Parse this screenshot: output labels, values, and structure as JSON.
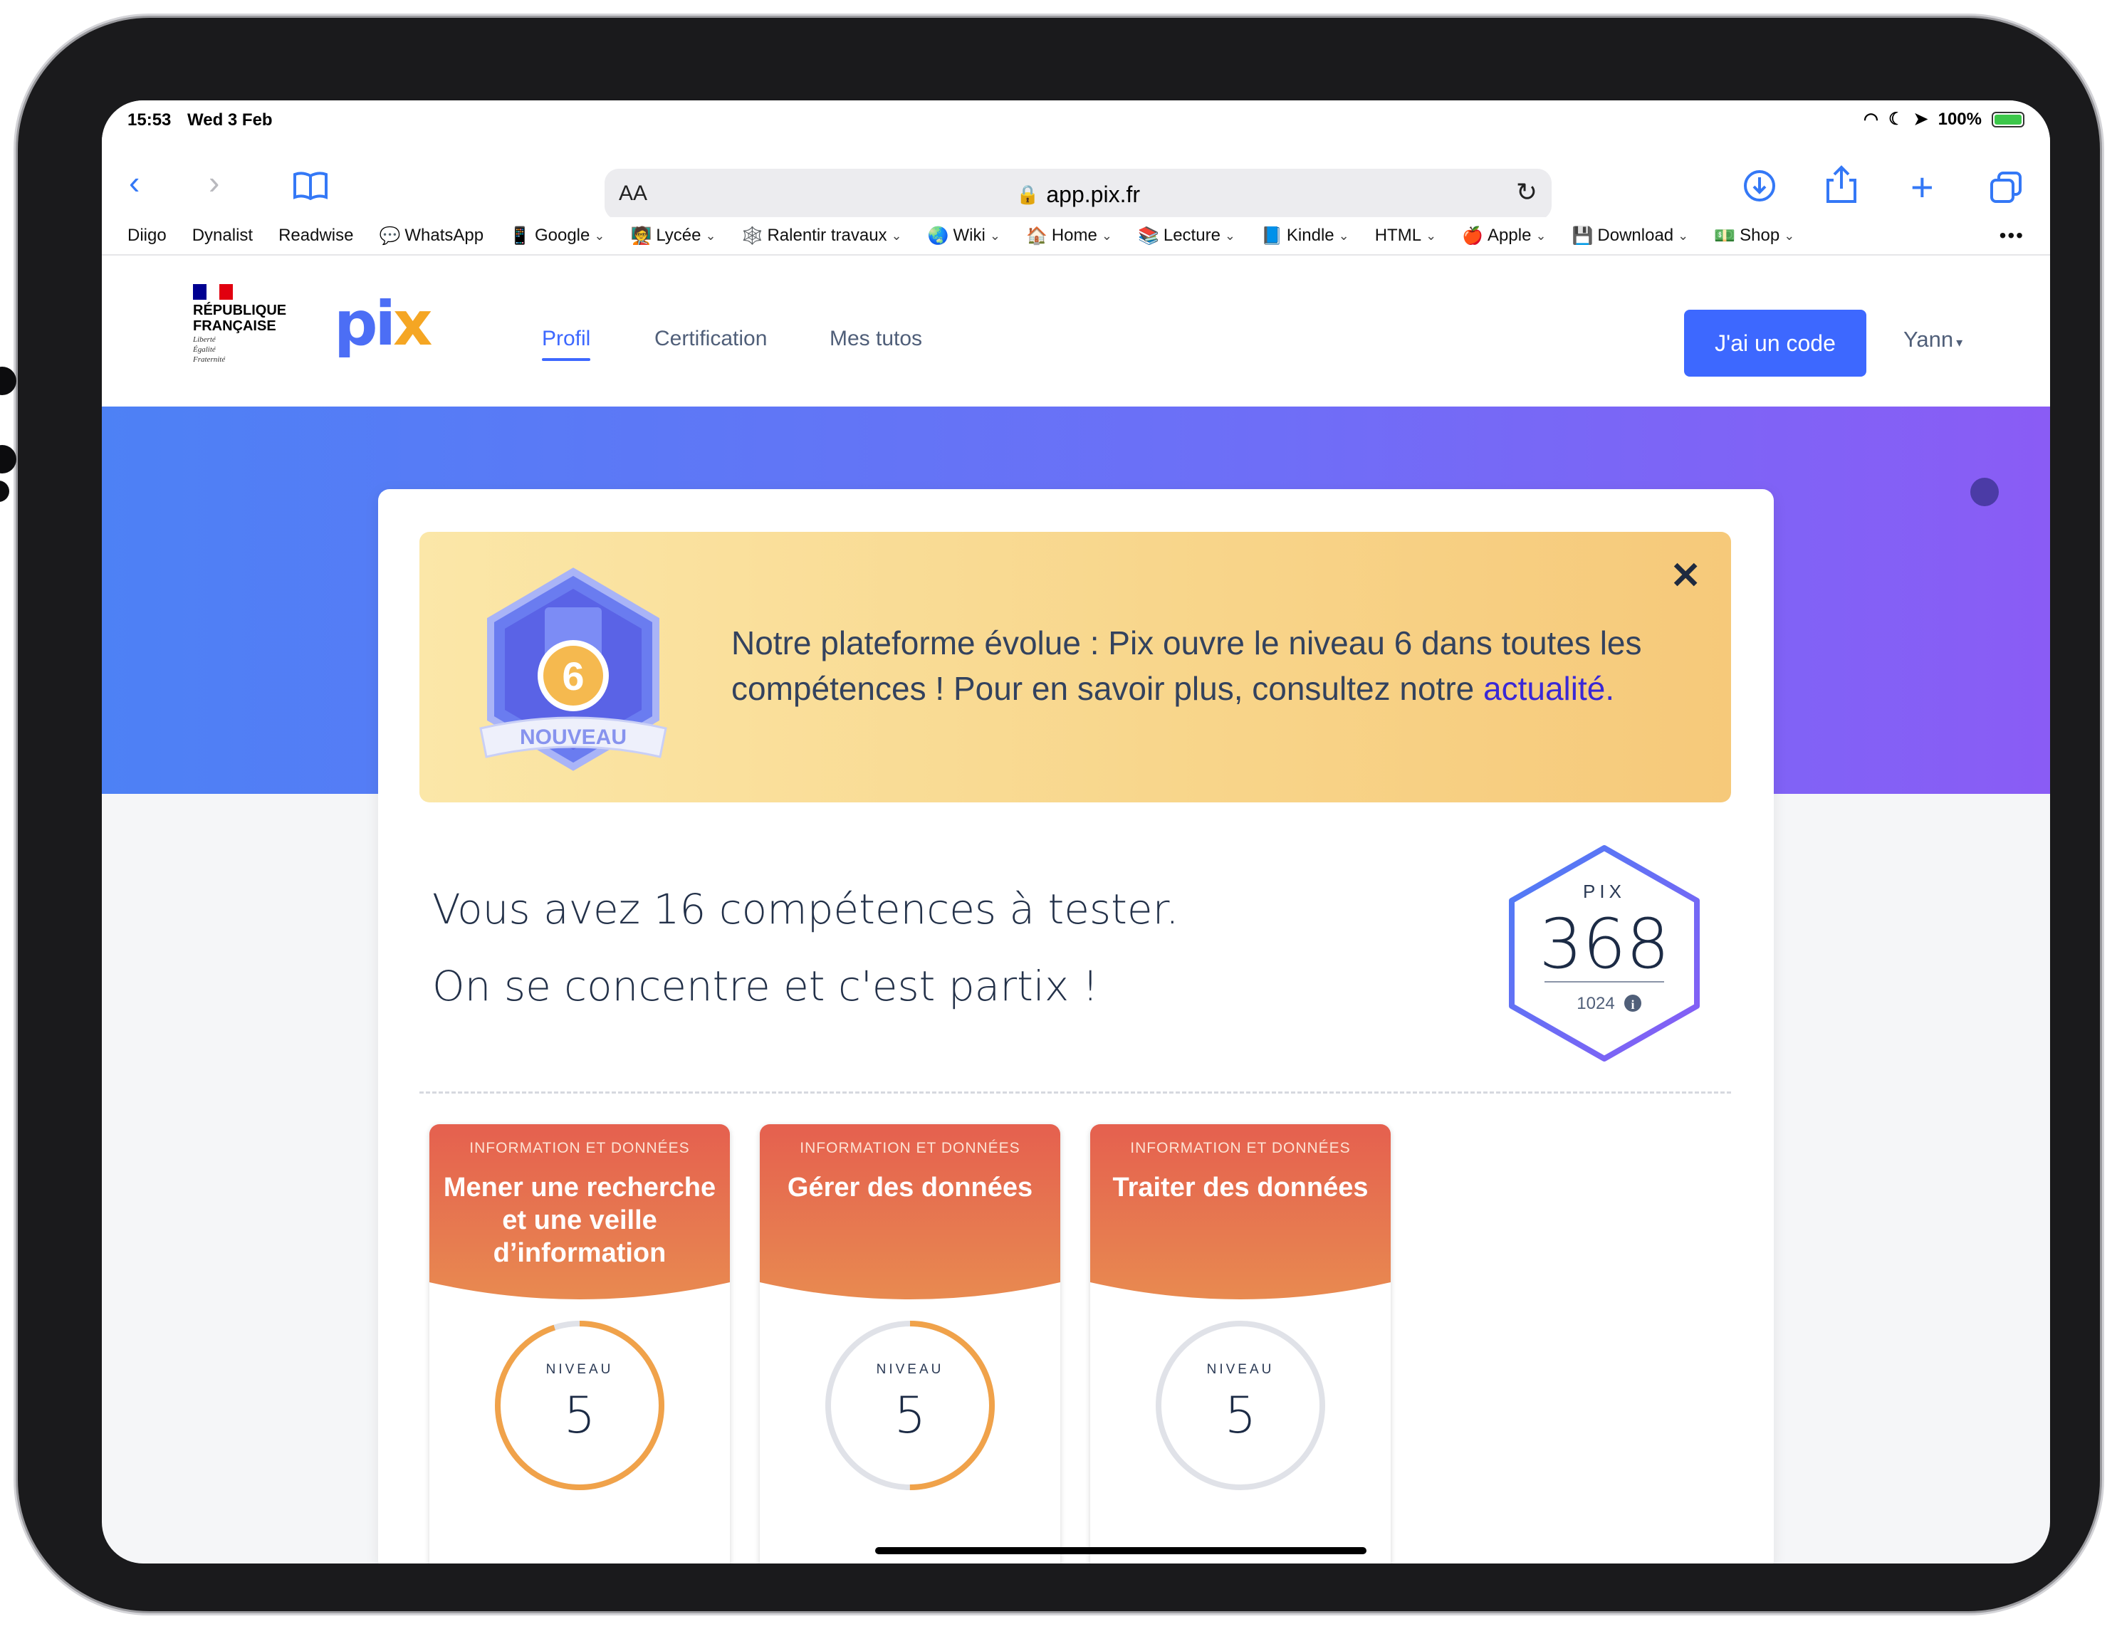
{
  "status_bar": {
    "time": "15:53",
    "date": "Wed 3 Feb",
    "battery": "100%"
  },
  "browser": {
    "url": "app.pix.fr",
    "aa_label": "AA",
    "bookmarks": [
      {
        "label": "Diigo",
        "icon": "",
        "has_menu": false
      },
      {
        "label": "Dynalist",
        "icon": "",
        "has_menu": false
      },
      {
        "label": "Readwise",
        "icon": "",
        "has_menu": false
      },
      {
        "label": "WhatsApp",
        "icon": "💬",
        "has_menu": false
      },
      {
        "label": "Google",
        "icon": "📱",
        "has_menu": true
      },
      {
        "label": "Lycée",
        "icon": "🧑‍🏫",
        "has_menu": true
      },
      {
        "label": "Ralentir travaux",
        "icon": "🕸️",
        "has_menu": true
      },
      {
        "label": "Wiki",
        "icon": "🌏",
        "has_menu": true
      },
      {
        "label": "Home",
        "icon": "🏠",
        "has_menu": true
      },
      {
        "label": "Lecture",
        "icon": "📚",
        "has_menu": true
      },
      {
        "label": "Kindle",
        "icon": "📘",
        "has_menu": true
      },
      {
        "label": "HTML",
        "icon": "",
        "has_menu": true
      },
      {
        "label": "Apple",
        "icon": "🍎",
        "has_menu": true
      },
      {
        "label": "Download",
        "icon": "💾",
        "has_menu": true
      },
      {
        "label": "Shop",
        "icon": "💵",
        "has_menu": true
      }
    ],
    "more_label": "•••"
  },
  "header": {
    "rf_line1": "RÉPUBLIQUE",
    "rf_line2": "FRANÇAISE",
    "rf_motto1": "Liberté",
    "rf_motto2": "Égalité",
    "rf_motto3": "Fraternité",
    "logo_main": "pi",
    "logo_x": "x",
    "nav": {
      "profil": "Profil",
      "certification": "Certification",
      "tutos": "Mes tutos"
    },
    "code_button": "J'ai un code",
    "user": "Yann"
  },
  "banner": {
    "text": "Notre plateforme évolue : Pix ouvre le niveau 6 dans toutes les compétences ! Pour en savoir plus, consultez notre ",
    "link": "actualité",
    "suffix": ".",
    "badge_number": "6",
    "badge_label": "NOUVEAU"
  },
  "intro": {
    "line1": "Vous avez 16 compétences à tester.",
    "line2": "On se concentre et c'est partix !"
  },
  "score": {
    "label": "PIX",
    "value": "368",
    "max": "1024"
  },
  "competences": [
    {
      "domain": "INFORMATION ET DONNÉES",
      "name": "Mener une recherche et une veille d’information",
      "level_label": "NIVEAU",
      "level": "5",
      "progress": 0.95
    },
    {
      "domain": "INFORMATION ET DONNÉES",
      "name": "Gérer des données",
      "level_label": "NIVEAU",
      "level": "5",
      "progress": 0.5
    },
    {
      "domain": "INFORMATION ET DONNÉES",
      "name": "Traiter des données",
      "level_label": "NIVEAU",
      "level": "5",
      "progress": 0.0
    }
  ],
  "colors": {
    "accent": "#3d68ff",
    "card_head": "#e8704f",
    "gauge": "#f0a24a"
  }
}
